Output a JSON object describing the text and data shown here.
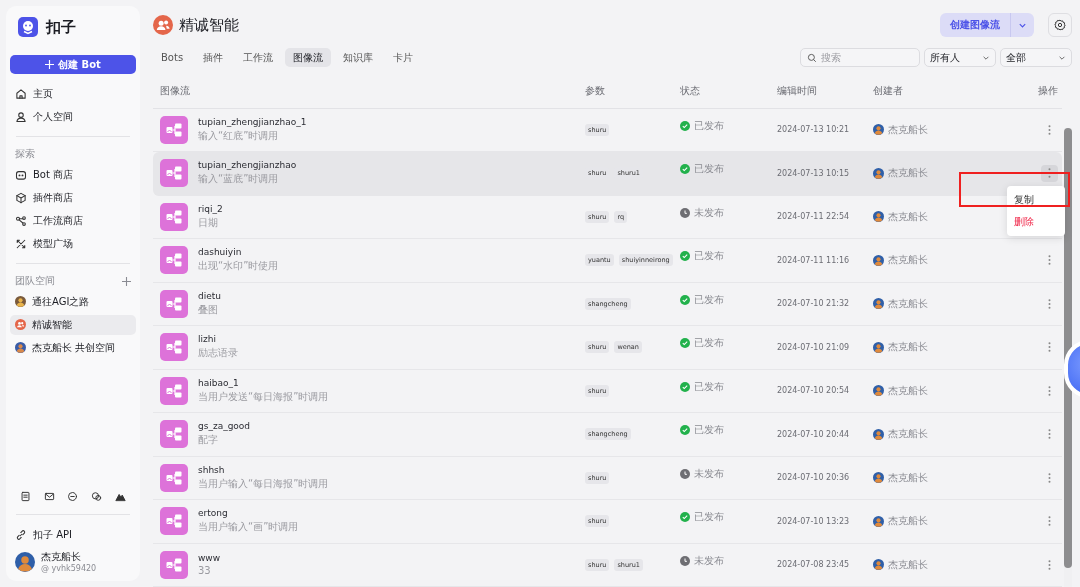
{
  "sidebar": {
    "brand": "扣子",
    "create_button": "创建 Bot",
    "nav": [
      {
        "label": "主页",
        "selected": false
      },
      {
        "label": "个人空间",
        "selected": false
      }
    ],
    "explore": {
      "title": "探索",
      "items": [
        {
          "label": "Bot 商店"
        },
        {
          "label": "插件商店"
        },
        {
          "label": "工作流商店"
        },
        {
          "label": "模型广场"
        }
      ]
    },
    "teams": {
      "title": "团队空间",
      "items": [
        {
          "label": "通往AGI之路",
          "selected": false
        },
        {
          "label": "精诚智能",
          "selected": true
        },
        {
          "label": "杰克船长 共创空间",
          "selected": false
        }
      ]
    },
    "api_link": "扣子 API",
    "user": {
      "name": "杰克船长",
      "handle": "@ yvhk59420"
    }
  },
  "header": {
    "title": "精诚智能",
    "create_button": "创建图像流"
  },
  "tabs": [
    {
      "label": "Bots",
      "selected": false
    },
    {
      "label": "插件",
      "selected": false
    },
    {
      "label": "工作流",
      "selected": false
    },
    {
      "label": "图像流",
      "selected": true
    },
    {
      "label": "知识库",
      "selected": false
    },
    {
      "label": "卡片",
      "selected": false
    }
  ],
  "filters": {
    "search_placeholder": "搜索",
    "owner": "所有人",
    "status": "全部"
  },
  "table": {
    "columns": [
      "图像流",
      "参数",
      "状态",
      "编辑时间",
      "创建者",
      "操作"
    ],
    "rows": [
      {
        "name": "tupian_zhengjianzhao_1",
        "desc": "输入“红底”时调用",
        "params": [
          "shuru"
        ],
        "status": {
          "kind": "published",
          "label": "已发布"
        },
        "time": "2024-07-13 10:21",
        "creator": "杰克船长",
        "selected": false,
        "menu_open": false
      },
      {
        "name": "tupian_zhengjianzhao",
        "desc": "输入“蓝底”时调用",
        "params": [
          "shuru",
          "shuru1"
        ],
        "status": {
          "kind": "published",
          "label": "已发布"
        },
        "time": "2024-07-13 10:15",
        "creator": "杰克船长",
        "selected": true,
        "menu_open": true
      },
      {
        "name": "riqi_2",
        "desc": "日期",
        "params": [
          "shuru",
          "rq"
        ],
        "status": {
          "kind": "draft",
          "label": "未发布"
        },
        "time": "2024-07-11 22:54",
        "creator": "杰克船长",
        "selected": false,
        "menu_open": false
      },
      {
        "name": "dashuiyin",
        "desc": "出现“水印”时使用",
        "params": [
          "yuantu",
          "shuiyinneirong"
        ],
        "status": {
          "kind": "published",
          "label": "已发布"
        },
        "time": "2024-07-11 11:16",
        "creator": "杰克船长",
        "selected": false,
        "menu_open": false
      },
      {
        "name": "dietu",
        "desc": "叠图",
        "params": [
          "shangcheng"
        ],
        "status": {
          "kind": "published",
          "label": "已发布"
        },
        "time": "2024-07-10 21:32",
        "creator": "杰克船长",
        "selected": false,
        "menu_open": false
      },
      {
        "name": "lizhi",
        "desc": "励志语录",
        "params": [
          "shuru",
          "wenan"
        ],
        "status": {
          "kind": "published",
          "label": "已发布"
        },
        "time": "2024-07-10 21:09",
        "creator": "杰克船长",
        "selected": false,
        "menu_open": false
      },
      {
        "name": "haibao_1",
        "desc": "当用户发送“每日海报”时调用",
        "params": [
          "shuru"
        ],
        "status": {
          "kind": "published",
          "label": "已发布"
        },
        "time": "2024-07-10 20:54",
        "creator": "杰克船长",
        "selected": false,
        "menu_open": false
      },
      {
        "name": "gs_za_good",
        "desc": "配字",
        "params": [
          "shangcheng"
        ],
        "status": {
          "kind": "published",
          "label": "已发布"
        },
        "time": "2024-07-10 20:44",
        "creator": "杰克船长",
        "selected": false,
        "menu_open": false
      },
      {
        "name": "shhsh",
        "desc": "当用户输入“每日海报”时调用",
        "params": [
          "shuru"
        ],
        "status": {
          "kind": "draft",
          "label": "未发布"
        },
        "time": "2024-07-10 20:36",
        "creator": "杰克船长",
        "selected": false,
        "menu_open": false
      },
      {
        "name": "ertong",
        "desc": "当用户输入“画”时调用",
        "params": [
          "shuru"
        ],
        "status": {
          "kind": "published",
          "label": "已发布"
        },
        "time": "2024-07-10 13:23",
        "creator": "杰克船长",
        "selected": false,
        "menu_open": false
      },
      {
        "name": "www",
        "desc": "33",
        "params": [
          "shuru",
          "shuru1"
        ],
        "status": {
          "kind": "draft",
          "label": "未发布"
        },
        "time": "2024-07-08 23:45",
        "creator": "杰克船长",
        "selected": false,
        "menu_open": false
      }
    ]
  },
  "row_menu": {
    "highlighted": true,
    "items": [
      {
        "label": "复制",
        "kind": "normal"
      },
      {
        "label": "删除",
        "kind": "danger"
      }
    ]
  }
}
